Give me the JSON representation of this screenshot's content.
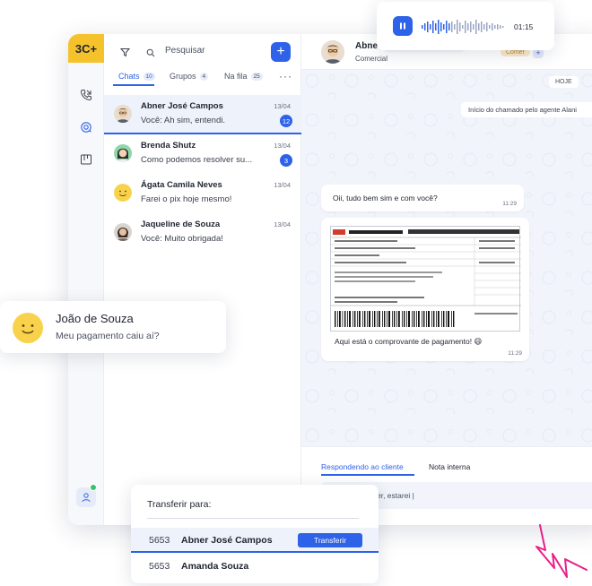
{
  "app": {
    "logo": "3C+",
    "brand_color": "#2e62e8",
    "accent_yellow": "#f6c22b"
  },
  "rail": {
    "items": [
      "phone-call-icon",
      "headset-icon",
      "board-icon"
    ],
    "user_icon": "user-icon",
    "status": "online"
  },
  "chat_list": {
    "search_label": "Pesquisar",
    "tabs": [
      {
        "label": "Chats",
        "count": "10",
        "active": true
      },
      {
        "label": "Grupos",
        "count": "4",
        "active": false
      },
      {
        "label": "Na fila",
        "count": "25",
        "active": false
      }
    ],
    "more": "···",
    "conversations": [
      {
        "name": "Abner José Campos",
        "preview": "Você: Ah sim, entendi.",
        "date": "13/04",
        "unread": "12",
        "active": true
      },
      {
        "name": "Brenda Shutz",
        "preview": "Como podemos resolver su...",
        "date": "13/04",
        "unread": "3",
        "active": false
      },
      {
        "name": "Ágata Camila Neves",
        "preview": "Farei o pix hoje mesmo!",
        "date": "13/04",
        "unread": "",
        "active": false
      },
      {
        "name": "Jaqueline de Souza",
        "preview": "Você: Muito obrigada!",
        "date": "13/04",
        "unread": "",
        "active": false
      }
    ]
  },
  "conversation": {
    "header_name": "Abne",
    "header_sub": "Comercial",
    "header_tag": "Comer",
    "date_label": "HOJE",
    "system_message": "Início do chamado pelo agente Alani",
    "messages": [
      {
        "text": "Oii, tudo bem sim e com você?",
        "time": "11:29"
      },
      {
        "text": "Aqui está o comprovante de pagamento! 😄",
        "time": "11:29",
        "attachment": "boleto"
      }
    ],
    "reply_tabs": [
      "Respondendo ao cliente",
      "Nota interna"
    ],
    "reply_text": "er, estarei |"
  },
  "audio": {
    "time": "01:15"
  },
  "notification": {
    "name": "João de Souza",
    "message": "Meu pagamento caiu aí?"
  },
  "transfer": {
    "title": "Transferir para:",
    "button": "Transferir",
    "options": [
      {
        "ext": "5653",
        "name": "Abner José Campos",
        "active": true
      },
      {
        "ext": "5653",
        "name": "Amanda Souza",
        "active": false
      }
    ]
  }
}
